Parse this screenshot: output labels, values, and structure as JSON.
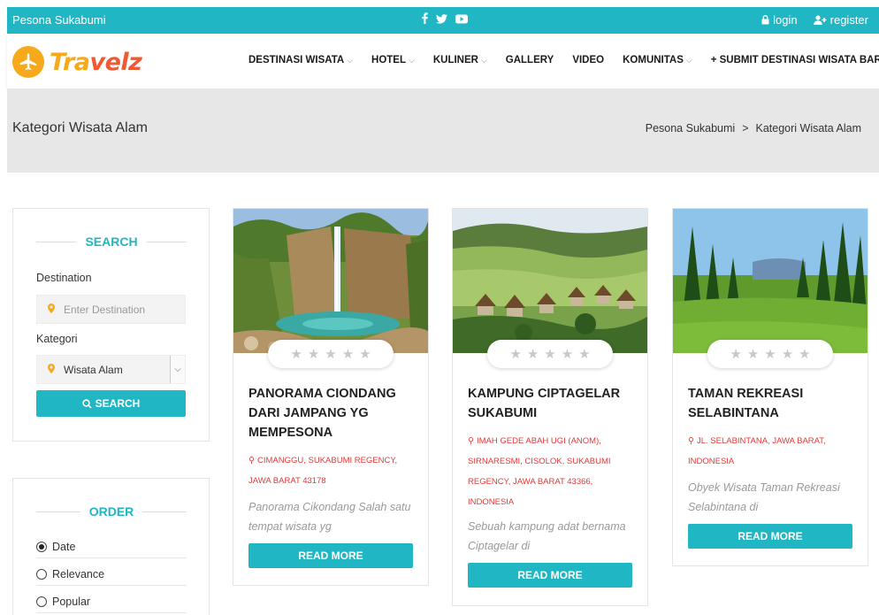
{
  "topbar": {
    "site_name": "Pesona Sukabumi",
    "social_icons": [
      "facebook-icon",
      "twitter-icon",
      "youtube-icon"
    ],
    "login_label": "login",
    "register_label": "register"
  },
  "brand": {
    "part1": "Tra",
    "part2": "velz"
  },
  "nav": {
    "items": [
      {
        "label": "DESTINASI WISATA",
        "dropdown": true
      },
      {
        "label": "HOTEL",
        "dropdown": true
      },
      {
        "label": "KULINER",
        "dropdown": true
      },
      {
        "label": "GALLERY",
        "dropdown": false
      },
      {
        "label": "VIDEO",
        "dropdown": false
      },
      {
        "label": "KOMUNITAS",
        "dropdown": true
      },
      {
        "label": "+ SUBMIT DESTINASI WISATA BARU",
        "dropdown": false
      }
    ]
  },
  "hero": {
    "title": "Kategori Wisata Alam",
    "breadcrumb": [
      "Pesona Sukabumi",
      "Kategori Wisata Alam"
    ],
    "breadcrumb_sep": ">"
  },
  "search_widget": {
    "title": "SEARCH",
    "destination_label": "Destination",
    "destination_placeholder": "Enter Destination",
    "kategori_label": "Kategori",
    "kategori_value": "Wisata Alam",
    "button_label": "SEARCH"
  },
  "order_widget": {
    "title": "ORDER",
    "options": [
      {
        "label": "Date",
        "checked": true
      },
      {
        "label": "Relevance",
        "checked": false
      },
      {
        "label": "Popular",
        "checked": false
      }
    ]
  },
  "cards": [
    {
      "title": "PANORAMA CIONDANG DARI JAMPANG YG MEMPESONA",
      "location": "CIMANGGU, SUKABUMI REGENCY, JAWA BARAT 43178",
      "excerpt": "Panorama Cikondang Salah satu tempat wisata yg",
      "rating": 0,
      "button": "READ MORE"
    },
    {
      "title": "KAMPUNG CIPTAGELAR SUKABUMI",
      "location": "IMAH GEDE ABAH UGI (ANOM), SIRNARESMI, CISOLOK, SUKABUMI REGENCY, JAWA BARAT 43366, INDONESIA",
      "excerpt": "Sebuah kampung adat bernama Ciptagelar di",
      "rating": 0,
      "button": "READ MORE"
    },
    {
      "title": "TAMAN REKREASI SELABINTANA",
      "location": "JL. SELABINTANA, JAWA BARAT, INDONESIA",
      "excerpt": "Obyek Wisata Taman Rekreasi Selabintana di",
      "rating": 0,
      "button": "READ MORE"
    }
  ],
  "colors": {
    "accent": "#21b6c3",
    "brand_orange": "#f7a91b",
    "brand_red": "#ef5a32",
    "location_red": "#e23a3a"
  }
}
